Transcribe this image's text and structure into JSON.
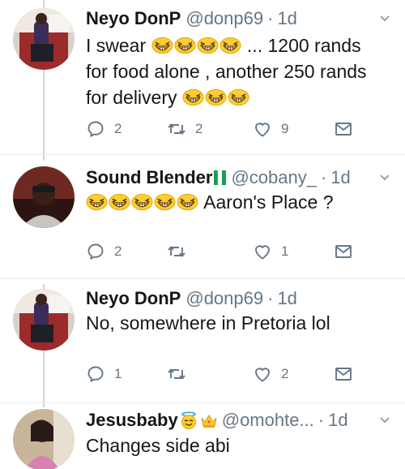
{
  "tweets": [
    {
      "name": "Neyo DonP",
      "handle": "@donp69",
      "time": "1d",
      "text_pre": "I swear",
      "text_mid": "... 1200 rands for food alone , another 250 rands for delivery",
      "icons": {
        "avatar": "avatar-car-photo",
        "emoji": "grinning-squinting-face"
      },
      "actions": {
        "replies": "2",
        "retweets": "2",
        "likes": "9"
      }
    },
    {
      "name": "Sound Blender",
      "handle": "@cobany_",
      "time": "1d",
      "text": "Aaron's Place ?",
      "icons": {
        "avatar": "avatar-dark-photo",
        "flag": "nigeria-flag",
        "emoji": "grinning-squinting-face"
      },
      "actions": {
        "replies": "2",
        "retweets": "",
        "likes": "1"
      }
    },
    {
      "name": "Neyo DonP",
      "handle": "@donp69",
      "time": "1d",
      "text": "No, somewhere in Pretoria lol",
      "icons": {
        "avatar": "avatar-car-photo"
      },
      "actions": {
        "replies": "1",
        "retweets": "",
        "likes": "2"
      }
    },
    {
      "name": "Jesusbaby",
      "handle": "@omohte...",
      "time": "1d",
      "text": "Changes side abi",
      "icons": {
        "avatar": "avatar-selfie-photo",
        "badges": [
          "smiling-face-with-halo",
          "crown"
        ]
      }
    }
  ],
  "separator": "·",
  "colors": {
    "text": "#14171a",
    "muted": "#657786",
    "divider": "#e6ecf0",
    "thread": "#ccd6dd"
  }
}
